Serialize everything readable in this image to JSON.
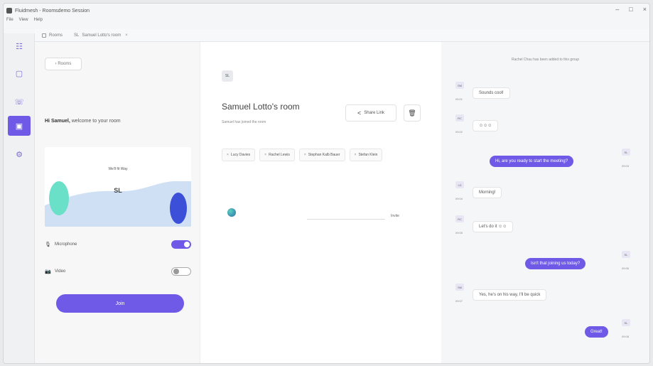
{
  "window": {
    "title": "Fluidmesh - Roomsdemo Session",
    "menu": [
      "File",
      "View",
      "Help"
    ],
    "controls": {
      "minimize": "–",
      "maximize": "□",
      "close": "×"
    }
  },
  "tabs": [
    {
      "label": "Rooms"
    },
    {
      "label": "SL",
      "extra": "Samuel Lotto's room"
    }
  ],
  "rail": {
    "items": [
      {
        "name": "rail-item-home",
        "icon": "☷"
      },
      {
        "name": "rail-item-chat",
        "icon": "▢"
      },
      {
        "name": "rail-item-calls",
        "icon": "☏"
      },
      {
        "name": "rail-item-rooms",
        "icon": "▣"
      },
      {
        "name": "rail-item-settings",
        "icon": "⚙"
      }
    ]
  },
  "join": {
    "back_label": "‹ Rooms",
    "welcome_bold": "Hi Samuel,",
    "welcome_rest": " welcome to your room",
    "preview_label": "We'll fit Way",
    "preview_initials": "SL",
    "microphone_label": "Microphone",
    "microphone_icon": "🎙",
    "video_label": "Video",
    "video_icon": "📷",
    "join_label": "Join"
  },
  "room": {
    "avatar_initials": "SL",
    "title": "Samuel Lotto's room",
    "subtitle": "Samuel has joined the room",
    "share_label": "Share Link",
    "share_icon": "<",
    "trash_icon": "🗑",
    "participants": [
      "Lucy Davies",
      "Rachel Lewis",
      "Stephan Kalb Bauer",
      "Stefan Klein"
    ],
    "stage_label": "Invite"
  },
  "chat": {
    "notice": "Rachel Chau has been added to this group",
    "messages": [
      {
        "dir": "in",
        "avatar": "SM",
        "time": "09:01",
        "text": "Sounds cool!"
      },
      {
        "dir": "in",
        "avatar": "RC",
        "time": "09:02",
        "text": "☺☺☺"
      },
      {
        "dir": "out",
        "avatar": "SL",
        "time": "09:03",
        "text": "Hi, are you ready to start the meeting?"
      },
      {
        "dir": "in",
        "avatar": "LD",
        "time": "09:04",
        "text": "Morning!"
      },
      {
        "dir": "in",
        "avatar": "RC",
        "time": "09:05",
        "text": "Let's do it ☺☺"
      },
      {
        "dir": "out",
        "avatar": "SL",
        "time": "09:06",
        "text": "Isn't that joining us today?"
      },
      {
        "dir": "in",
        "avatar": "SM",
        "time": "09:07",
        "text": "Yes, he's on his way, I'll be quick"
      },
      {
        "dir": "out",
        "avatar": "SL",
        "time": "09:08",
        "text": "Great!"
      }
    ]
  },
  "colors": {
    "accent": "#6e5ae6",
    "panel": "#f7f7f8"
  }
}
